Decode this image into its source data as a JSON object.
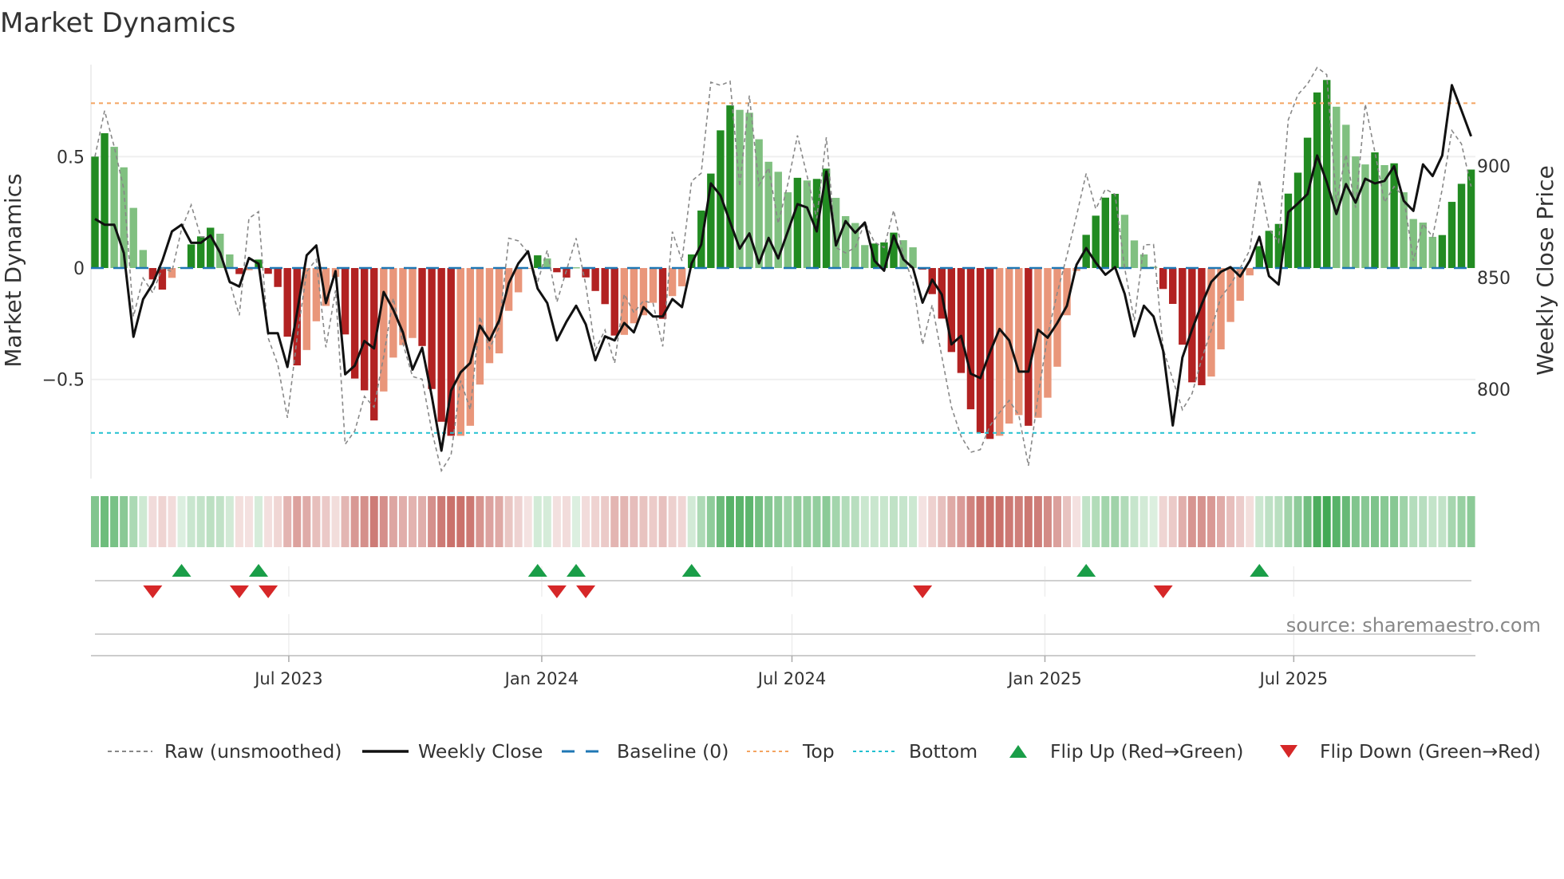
{
  "title": "Market Dynamics",
  "source": "source: sharemaestro.com",
  "colors": {
    "pos_strong": "#228b22",
    "pos_weak": "#80c080",
    "neg_strong": "#b22222",
    "neg_weak": "#e9967a",
    "strip_pos": "#41a854",
    "strip_neg": "#c4625c",
    "raw": "#888888",
    "close": "#111111",
    "baseline": "#1f77b4",
    "top": "#f4a460",
    "bottom": "#22c0d0",
    "flip_up": "#1a9e48",
    "flip_down": "#d62728"
  },
  "legend": {
    "raw": "Raw (unsmoothed)",
    "close": "Weekly Close",
    "baseline": "Baseline (0)",
    "top": "Top",
    "bottom": "Bottom",
    "flip_up": "Flip Up (Red→Green)",
    "flip_down": "Flip Down (Green→Red)"
  },
  "chart_data": {
    "type": "bar",
    "title": "Market Dynamics",
    "ylabel": "Market Dynamics",
    "y2label": "Weekly Close Price",
    "xlabel": "",
    "start_date": "2023-02-10",
    "frequency": "weekly",
    "ylim": [
      -0.945,
      0.913
    ],
    "y2lim": [
      760.7,
      946.1
    ],
    "yticks": [
      {
        "v": 0.5,
        "label": "0.5"
      },
      {
        "v": 0,
        "label": "0"
      },
      {
        "v": -0.5,
        "label": "−0.5"
      }
    ],
    "y2ticks": [
      {
        "v": 900,
        "label": "900"
      },
      {
        "v": 850,
        "label": "850"
      },
      {
        "v": 800,
        "label": "800"
      }
    ],
    "xticks": [
      {
        "date": "2023-07-01",
        "label": "Jul 2023"
      },
      {
        "date": "2024-01-01",
        "label": "Jan 2024"
      },
      {
        "date": "2024-07-01",
        "label": "Jul 2024"
      },
      {
        "date": "2025-01-01",
        "label": "Jan 2025"
      },
      {
        "date": "2025-07-01",
        "label": "Jul 2025"
      }
    ],
    "top_level": 0.74,
    "bottom_level": -0.74,
    "baseline": 0,
    "legend_position": "bottom",
    "momentum": [
      0.5,
      0.605,
      0.544,
      0.452,
      0.27,
      0.081,
      -0.051,
      -0.097,
      -0.044,
      0.003,
      0.106,
      0.142,
      0.181,
      0.154,
      0.061,
      -0.027,
      -0.01,
      0.038,
      -0.026,
      -0.085,
      -0.308,
      -0.437,
      -0.368,
      -0.239,
      -0.17,
      -0.04,
      -0.298,
      -0.496,
      -0.549,
      -0.684,
      -0.554,
      -0.402,
      -0.346,
      -0.314,
      -0.35,
      -0.543,
      -0.69,
      -0.753,
      -0.753,
      -0.708,
      -0.523,
      -0.427,
      -0.383,
      -0.192,
      -0.109,
      -0.003,
      0.057,
      0.043,
      -0.019,
      -0.043,
      0.002,
      -0.042,
      -0.103,
      -0.162,
      -0.303,
      -0.3,
      -0.248,
      -0.212,
      -0.156,
      -0.228,
      -0.126,
      -0.082,
      0.061,
      0.258,
      0.424,
      0.618,
      0.73,
      0.71,
      0.697,
      0.578,
      0.477,
      0.432,
      0.34,
      0.405,
      0.393,
      0.4,
      0.446,
      0.315,
      0.233,
      0.202,
      0.103,
      0.11,
      0.115,
      0.159,
      0.125,
      0.093,
      -0.007,
      -0.117,
      -0.227,
      -0.377,
      -0.471,
      -0.634,
      -0.741,
      -0.767,
      -0.753,
      -0.698,
      -0.66,
      -0.708,
      -0.672,
      -0.582,
      -0.443,
      -0.212,
      -0.013,
      0.149,
      0.235,
      0.316,
      0.333,
      0.239,
      0.124,
      0.061,
      0.006,
      -0.094,
      -0.161,
      -0.344,
      -0.513,
      -0.526,
      -0.487,
      -0.365,
      -0.242,
      -0.147,
      -0.033,
      0.098,
      0.167,
      0.198,
      0.334,
      0.428,
      0.585,
      0.788,
      0.844,
      0.724,
      0.643,
      0.501,
      0.465,
      0.519,
      0.462,
      0.47,
      0.34,
      0.22,
      0.204,
      0.14,
      0.148,
      0.297,
      0.378,
      0.442
    ],
    "raw": [
      0.5,
      0.706,
      0.545,
      0.354,
      -0.218,
      -0.045,
      -0.111,
      0.0,
      -0.016,
      0.175,
      0.283,
      0.14,
      0.14,
      0.08,
      -0.063,
      -0.212,
      0.223,
      0.253,
      -0.314,
      -0.433,
      -0.672,
      -0.314,
      -0.016,
      0.038,
      -0.356,
      -0.1,
      -0.791,
      -0.731,
      -0.576,
      -0.624,
      -0.397,
      -0.135,
      -0.338,
      -0.487,
      -0.499,
      -0.731,
      -0.91,
      -0.84,
      -0.505,
      -0.636,
      -0.218,
      -0.362,
      -0.266,
      0.134,
      0.122,
      0.068,
      -0.063,
      0.08,
      -0.153,
      -0.01,
      0.134,
      -0.075,
      -0.368,
      -0.278,
      -0.427,
      -0.117,
      -0.2,
      -0.147,
      -0.159,
      -0.352,
      0.163,
      0.032,
      0.39,
      0.426,
      0.834,
      0.82,
      0.838,
      0.366,
      0.774,
      0.372,
      0.45,
      0.2,
      0.378,
      0.595,
      0.414,
      0.223,
      0.587,
      0.092,
      0.068,
      0.092,
      0.205,
      0.116,
      0.092,
      0.259,
      0.056,
      -0.063,
      -0.344,
      -0.165,
      -0.397,
      -0.624,
      -0.755,
      -0.827,
      -0.815,
      -0.708,
      -0.648,
      -0.594,
      -0.66,
      -0.887,
      -0.576,
      -0.302,
      -0.111,
      0.056,
      0.235,
      0.424,
      0.265,
      0.354,
      0.331,
      0.0,
      -0.236,
      0.104,
      0.106,
      -0.362,
      -0.5,
      -0.636,
      -0.564,
      -0.409,
      -0.278,
      -0.131,
      -0.075,
      0.0,
      0.08,
      0.396,
      0.175,
      0.116,
      0.665,
      0.778,
      0.826,
      0.9,
      0.868,
      0.295,
      0.51,
      0.271,
      0.736,
      0.521,
      0.295,
      0.366,
      0.319,
      0.032,
      0.199,
      0.14,
      0.354,
      0.617,
      0.557,
      0.366
    ],
    "close": [
      877,
      874.4,
      874.4,
      861.7,
      824.2,
      841,
      847.9,
      858.3,
      871.4,
      874.4,
      866.3,
      866.3,
      869.6,
      861.9,
      848.8,
      846.7,
      859.5,
      856.9,
      825.8,
      825.8,
      810.7,
      835.1,
      860.7,
      865.1,
      839.3,
      853.6,
      807.4,
      811.3,
      822.3,
      819,
      844.3,
      836.3,
      826.2,
      809.5,
      819.3,
      797.6,
      773.2,
      800,
      808.3,
      812.5,
      829.2,
      822.6,
      831.5,
      848.2,
      857.1,
      862.5,
      845.8,
      839.3,
      822.6,
      831,
      838.1,
      829.8,
      813.7,
      824.4,
      822.6,
      830.4,
      826.2,
      837.5,
      833.3,
      833.3,
      841.1,
      837.5,
      857.1,
      865.5,
      892.9,
      887.5,
      875.6,
      863.7,
      870.5,
      857.1,
      868.5,
      859.3,
      871.4,
      883.6,
      882.1,
      871.4,
      898.2,
      865.1,
      876,
      870.8,
      875.4,
      858.3,
      853.8,
      869.6,
      858.9,
      855,
      839.5,
      849.8,
      843.1,
      820.8,
      824.6,
      807.7,
      805.7,
      817.3,
      827.7,
      822.6,
      808.6,
      808.6,
      827.4,
      823.8,
      830.4,
      838.1,
      856.5,
      863.9,
      857.4,
      852,
      855.4,
      843.5,
      824.4,
      838.1,
      833.3,
      817.9,
      784.5,
      814.9,
      827.4,
      838.7,
      848.8,
      853.3,
      855.4,
      851.2,
      858.3,
      869,
      851.4,
      847.6,
      880,
      883.9,
      888.1,
      905.4,
      893.5,
      879.2,
      892.6,
      884.3,
      895,
      892.9,
      894,
      900.6,
      885.1,
      880.6,
      901.4,
      896.2,
      905.4,
      936.9,
      925.6,
      914
    ],
    "flip_up_weeks": [
      10,
      18,
      47,
      51,
      63,
      104,
      122
    ],
    "flip_down_weeks": [
      7,
      16,
      19,
      49,
      52,
      87,
      112
    ]
  }
}
